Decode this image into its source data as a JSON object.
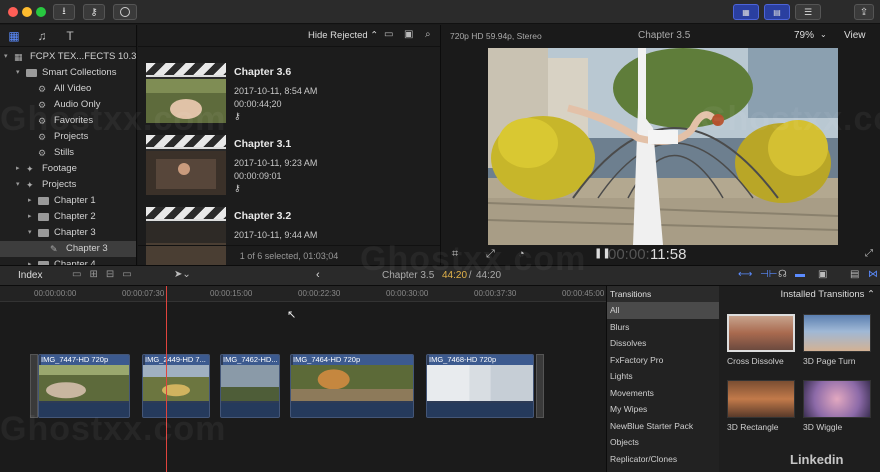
{
  "toolbar": {
    "buttons": [
      "import-icon",
      "keyword-icon",
      "background-tasks-icon",
      "browser-layout-icon",
      "timeline-layout-icon",
      "inspector-icon",
      "share-icon"
    ]
  },
  "library": {
    "rows": [
      {
        "label": "FCPX TEX...FECTS 10.3",
        "indent": 0,
        "tri": "▾",
        "kind": "library"
      },
      {
        "label": "Smart Collections",
        "indent": 1,
        "tri": "▾",
        "kind": "folder"
      },
      {
        "label": "All Video",
        "indent": 2,
        "tri": "",
        "kind": "gear"
      },
      {
        "label": "Audio Only",
        "indent": 2,
        "tri": "",
        "kind": "gear"
      },
      {
        "label": "Favorites",
        "indent": 2,
        "tri": "",
        "kind": "gear"
      },
      {
        "label": "Projects",
        "indent": 2,
        "tri": "",
        "kind": "gear"
      },
      {
        "label": "Stills",
        "indent": 2,
        "tri": "",
        "kind": "gear"
      },
      {
        "label": "Footage",
        "indent": 1,
        "tri": "▸",
        "kind": "star"
      },
      {
        "label": "Projects",
        "indent": 1,
        "tri": "▾",
        "kind": "star"
      },
      {
        "label": "Chapter 1",
        "indent": 2,
        "tri": "▸",
        "kind": "folder"
      },
      {
        "label": "Chapter 2",
        "indent": 2,
        "tri": "▸",
        "kind": "folder"
      },
      {
        "label": "Chapter 3",
        "indent": 2,
        "tri": "▾",
        "kind": "folder"
      },
      {
        "label": "Chapter 3",
        "indent": 3,
        "tri": "",
        "kind": "project",
        "selected": true
      },
      {
        "label": "Chapter 4",
        "indent": 2,
        "tri": "▸",
        "kind": "folder"
      }
    ]
  },
  "browser": {
    "filter_label": "Hide Rejected ⌃",
    "clips": [
      {
        "title": "Chapter 3.6",
        "date": "2017-10-11, 8:54 AM",
        "duration": "00:00:44;20",
        "key": "⚷"
      },
      {
        "title": "Chapter 3.1",
        "date": "2017-10-11, 9:23 AM",
        "duration": "00:00:09:01",
        "key": "⚷"
      },
      {
        "title": "Chapter 3.2",
        "date": "2017-10-11, 9:44 AM",
        "duration": "",
        "key": ""
      }
    ],
    "footer": "1 of 6 selected, 01:03;04"
  },
  "viewer": {
    "format": "720p HD 59.94p, Stereo",
    "title": "Chapter 3.5",
    "zoom": "79%",
    "view_menu": "View",
    "timecode": "11:58",
    "timecode_dim": "00:00:"
  },
  "timeline_bar": {
    "index_label": "Index",
    "project_name": "Chapter 3.5",
    "timecode_current": "44:20",
    "timecode_sep": " / ",
    "timecode_total": "44:20"
  },
  "timeline": {
    "ticks": [
      "00:00:00:00",
      "00:00:07:30",
      "00:00:15:00",
      "00:00:22:30",
      "00:00:30:00",
      "00:00:37:30",
      "00:00:45:00"
    ],
    "clips": [
      {
        "name": "IMG_7447-HD 720p"
      },
      {
        "name": "IMG_2449-HD 7..."
      },
      {
        "name": "IMG_7462-HD..."
      },
      {
        "name": "IMG_7464-HD 720p"
      },
      {
        "name": "IMG_7468-HD 720p"
      }
    ]
  },
  "transitions": {
    "header": "Transitions",
    "grid_title": "Installed Transitions ⌃",
    "categories": [
      "All",
      "Blurs",
      "Dissolves",
      "FxFactory Pro",
      "Lights",
      "Movements",
      "My Wipes",
      "NewBlue Starter Pack",
      "Objects",
      "Replicator/Clones"
    ],
    "selected_category": "All",
    "items": [
      "Cross Dissolve",
      "3D Page Turn",
      "3D Rectangle",
      "3D Wiggle"
    ]
  },
  "watermarks": [
    "Ghostxx.com",
    "Ghostxx.com",
    "Ghostxx.com",
    "Ghostxx.com"
  ],
  "branding": "Linkedin"
}
